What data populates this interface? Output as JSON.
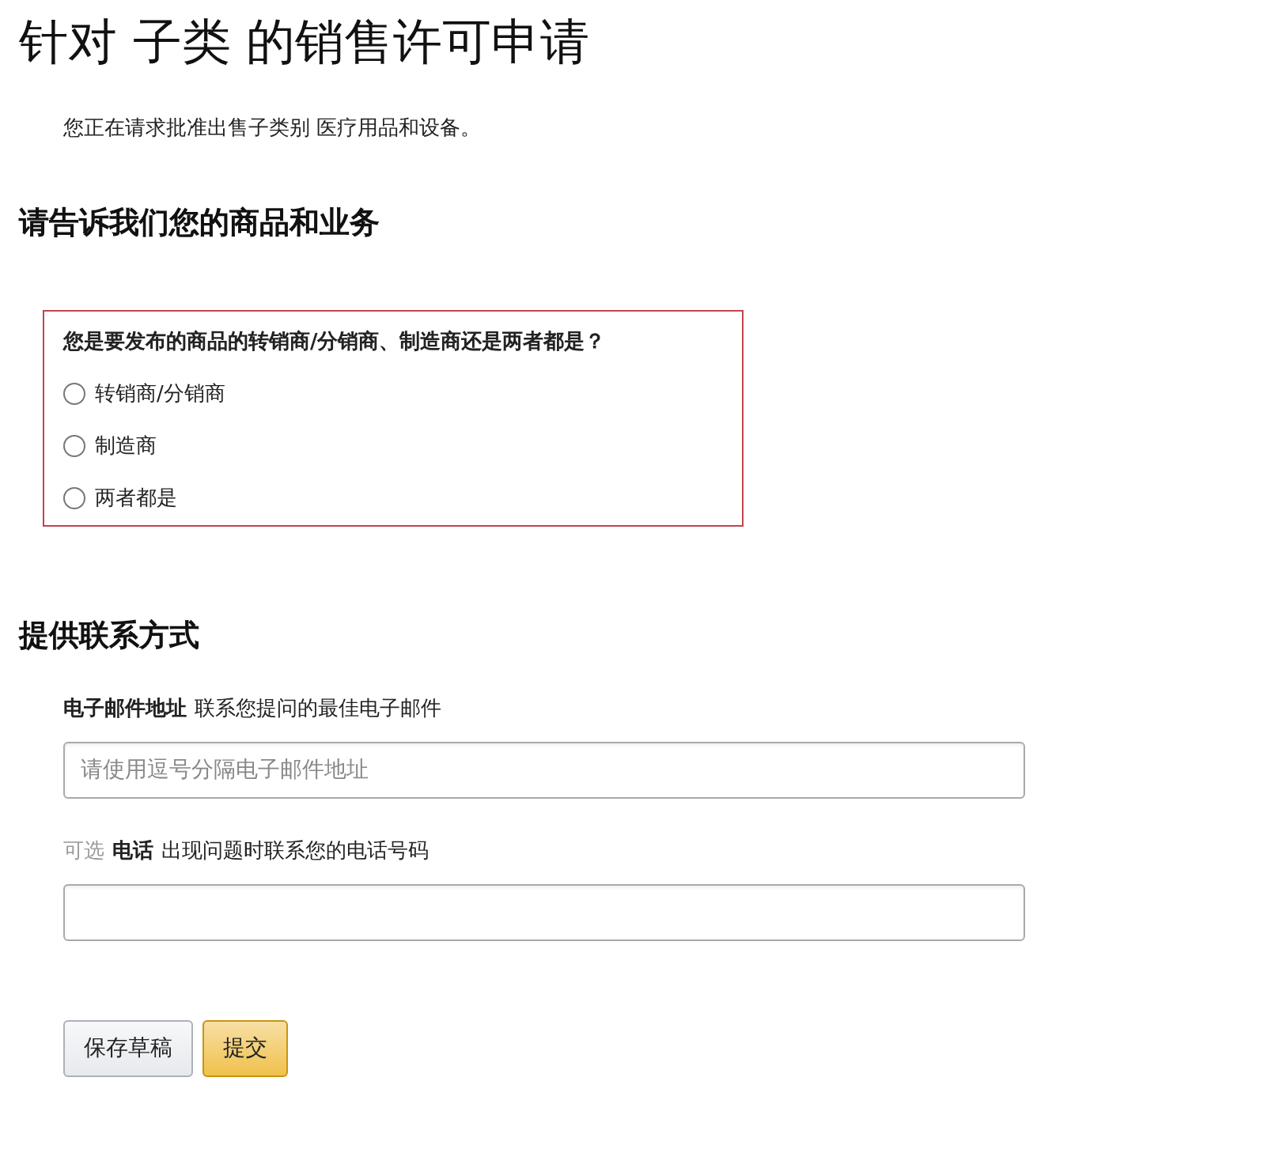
{
  "title": "针对 子类 的销售许可申请",
  "subtitle": "您正在请求批准出售子类别 医疗用品和设备。",
  "business_section": {
    "heading": "请告诉我们您的商品和业务",
    "question": "您是要发布的商品的转销商/分销商、制造商还是两者都是？",
    "options": [
      {
        "label": "转销商/分销商",
        "selected": false
      },
      {
        "label": "制造商",
        "selected": false
      },
      {
        "label": "两者都是",
        "selected": false
      }
    ]
  },
  "contact_section": {
    "heading": "提供联系方式",
    "fields": [
      {
        "label": "电子邮件地址",
        "hint": "联系您提问的最佳电子邮件",
        "placeholder": "请使用逗号分隔电子邮件地址"
      },
      {
        "optional_tag": "可选",
        "label": "电话",
        "hint": "出现问题时联系您的电话号码"
      }
    ]
  },
  "buttons": [
    {
      "label": "保存草稿",
      "kind": "secondary"
    },
    {
      "label": "提交",
      "kind": "primary"
    }
  ]
}
